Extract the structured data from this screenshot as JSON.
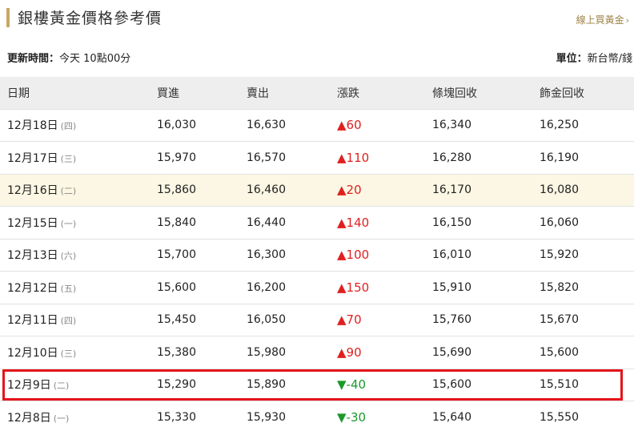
{
  "header": {
    "title": "銀樓黃金價格參考價",
    "buy_link": "線上買黃金",
    "buy_link_arrow": "›"
  },
  "info": {
    "update_label": "更新時間：",
    "update_value": "今天 10點00分",
    "unit_label": "單位：",
    "unit_value": "新台幣/錢"
  },
  "table": {
    "columns": [
      "日期",
      "買進",
      "賣出",
      "漲跌",
      "條塊回收",
      "飾金回收"
    ],
    "rows": [
      {
        "date": "12月18日",
        "weekday": "(四)",
        "buy": "16,030",
        "sell": "16,630",
        "change": "▲60",
        "dir": "up",
        "bar": "16,340",
        "jewelry": "16,250"
      },
      {
        "date": "12月17日",
        "weekday": "(三)",
        "buy": "15,970",
        "sell": "16,570",
        "change": "▲110",
        "dir": "up",
        "bar": "16,280",
        "jewelry": "16,190"
      },
      {
        "date": "12月16日",
        "weekday": "(二)",
        "buy": "15,860",
        "sell": "16,460",
        "change": "▲20",
        "dir": "up",
        "bar": "16,170",
        "jewelry": "16,080"
      },
      {
        "date": "12月15日",
        "weekday": "(一)",
        "buy": "15,840",
        "sell": "16,440",
        "change": "▲140",
        "dir": "up",
        "bar": "16,150",
        "jewelry": "16,060"
      },
      {
        "date": "12月13日",
        "weekday": "(六)",
        "buy": "15,700",
        "sell": "16,300",
        "change": "▲100",
        "dir": "up",
        "bar": "16,010",
        "jewelry": "15,920"
      },
      {
        "date": "12月12日",
        "weekday": "(五)",
        "buy": "15,600",
        "sell": "16,200",
        "change": "▲150",
        "dir": "up",
        "bar": "15,910",
        "jewelry": "15,820"
      },
      {
        "date": "12月11日",
        "weekday": "(四)",
        "buy": "15,450",
        "sell": "16,050",
        "change": "▲70",
        "dir": "up",
        "bar": "15,760",
        "jewelry": "15,670"
      },
      {
        "date": "12月10日",
        "weekday": "(三)",
        "buy": "15,380",
        "sell": "15,980",
        "change": "▲90",
        "dir": "up",
        "bar": "15,690",
        "jewelry": "15,600"
      },
      {
        "date": "12月9日",
        "weekday": "(二)",
        "buy": "15,290",
        "sell": "15,890",
        "change": "▼-40",
        "dir": "down",
        "bar": "15,600",
        "jewelry": "15,510"
      },
      {
        "date": "12月8日",
        "weekday": "(一)",
        "buy": "15,330",
        "sell": "15,930",
        "change": "▼-30",
        "dir": "down",
        "bar": "15,640",
        "jewelry": "15,550"
      }
    ]
  },
  "colors": {
    "accent_gold": "#c9a764",
    "up": "#e02020",
    "down": "#1a9a2a",
    "highlight_row": "#fbf7e4",
    "annotation_box": "#e4151b"
  }
}
